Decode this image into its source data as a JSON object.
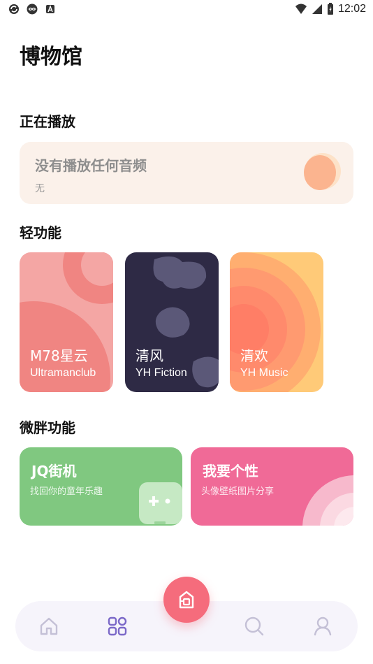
{
  "status_bar": {
    "time": "12:02",
    "icons": [
      "sync-icon",
      "infinity-icon",
      "a-badge-icon",
      "wifi-icon",
      "signal-icon",
      "battery-icon"
    ]
  },
  "page": {
    "title": "博物馆"
  },
  "now_playing": {
    "section_title": "正在播放",
    "title": "没有播放任何音频",
    "subtitle": "无"
  },
  "light_features": {
    "section_title": "轻功能",
    "cards": [
      {
        "name": "M78星云",
        "subtitle": "Ultramanclub",
        "color": "#f4a6a4"
      },
      {
        "name": "清风",
        "subtitle": "YH Fiction",
        "color": "#2e2a45"
      },
      {
        "name": "清欢",
        "subtitle": "YH Music",
        "color": "#ffca78"
      }
    ]
  },
  "wechat_features": {
    "section_title": "微胖功能",
    "cards": [
      {
        "title": "JQ街机",
        "description": "找回你的童年乐趣",
        "color": "#80c880",
        "icon": "gamepad-icon"
      },
      {
        "title": "我要个性",
        "description": "头像壁纸图片分享",
        "color": "#f06a97"
      }
    ]
  },
  "tab_bar": {
    "tabs": [
      "home-icon",
      "grid-icon",
      "search-icon",
      "user-icon"
    ],
    "active_tab": "grid-icon",
    "fab_icon": "museum-icon",
    "accent_color": "#7b68c8",
    "fab_color": "#f56c7c"
  }
}
